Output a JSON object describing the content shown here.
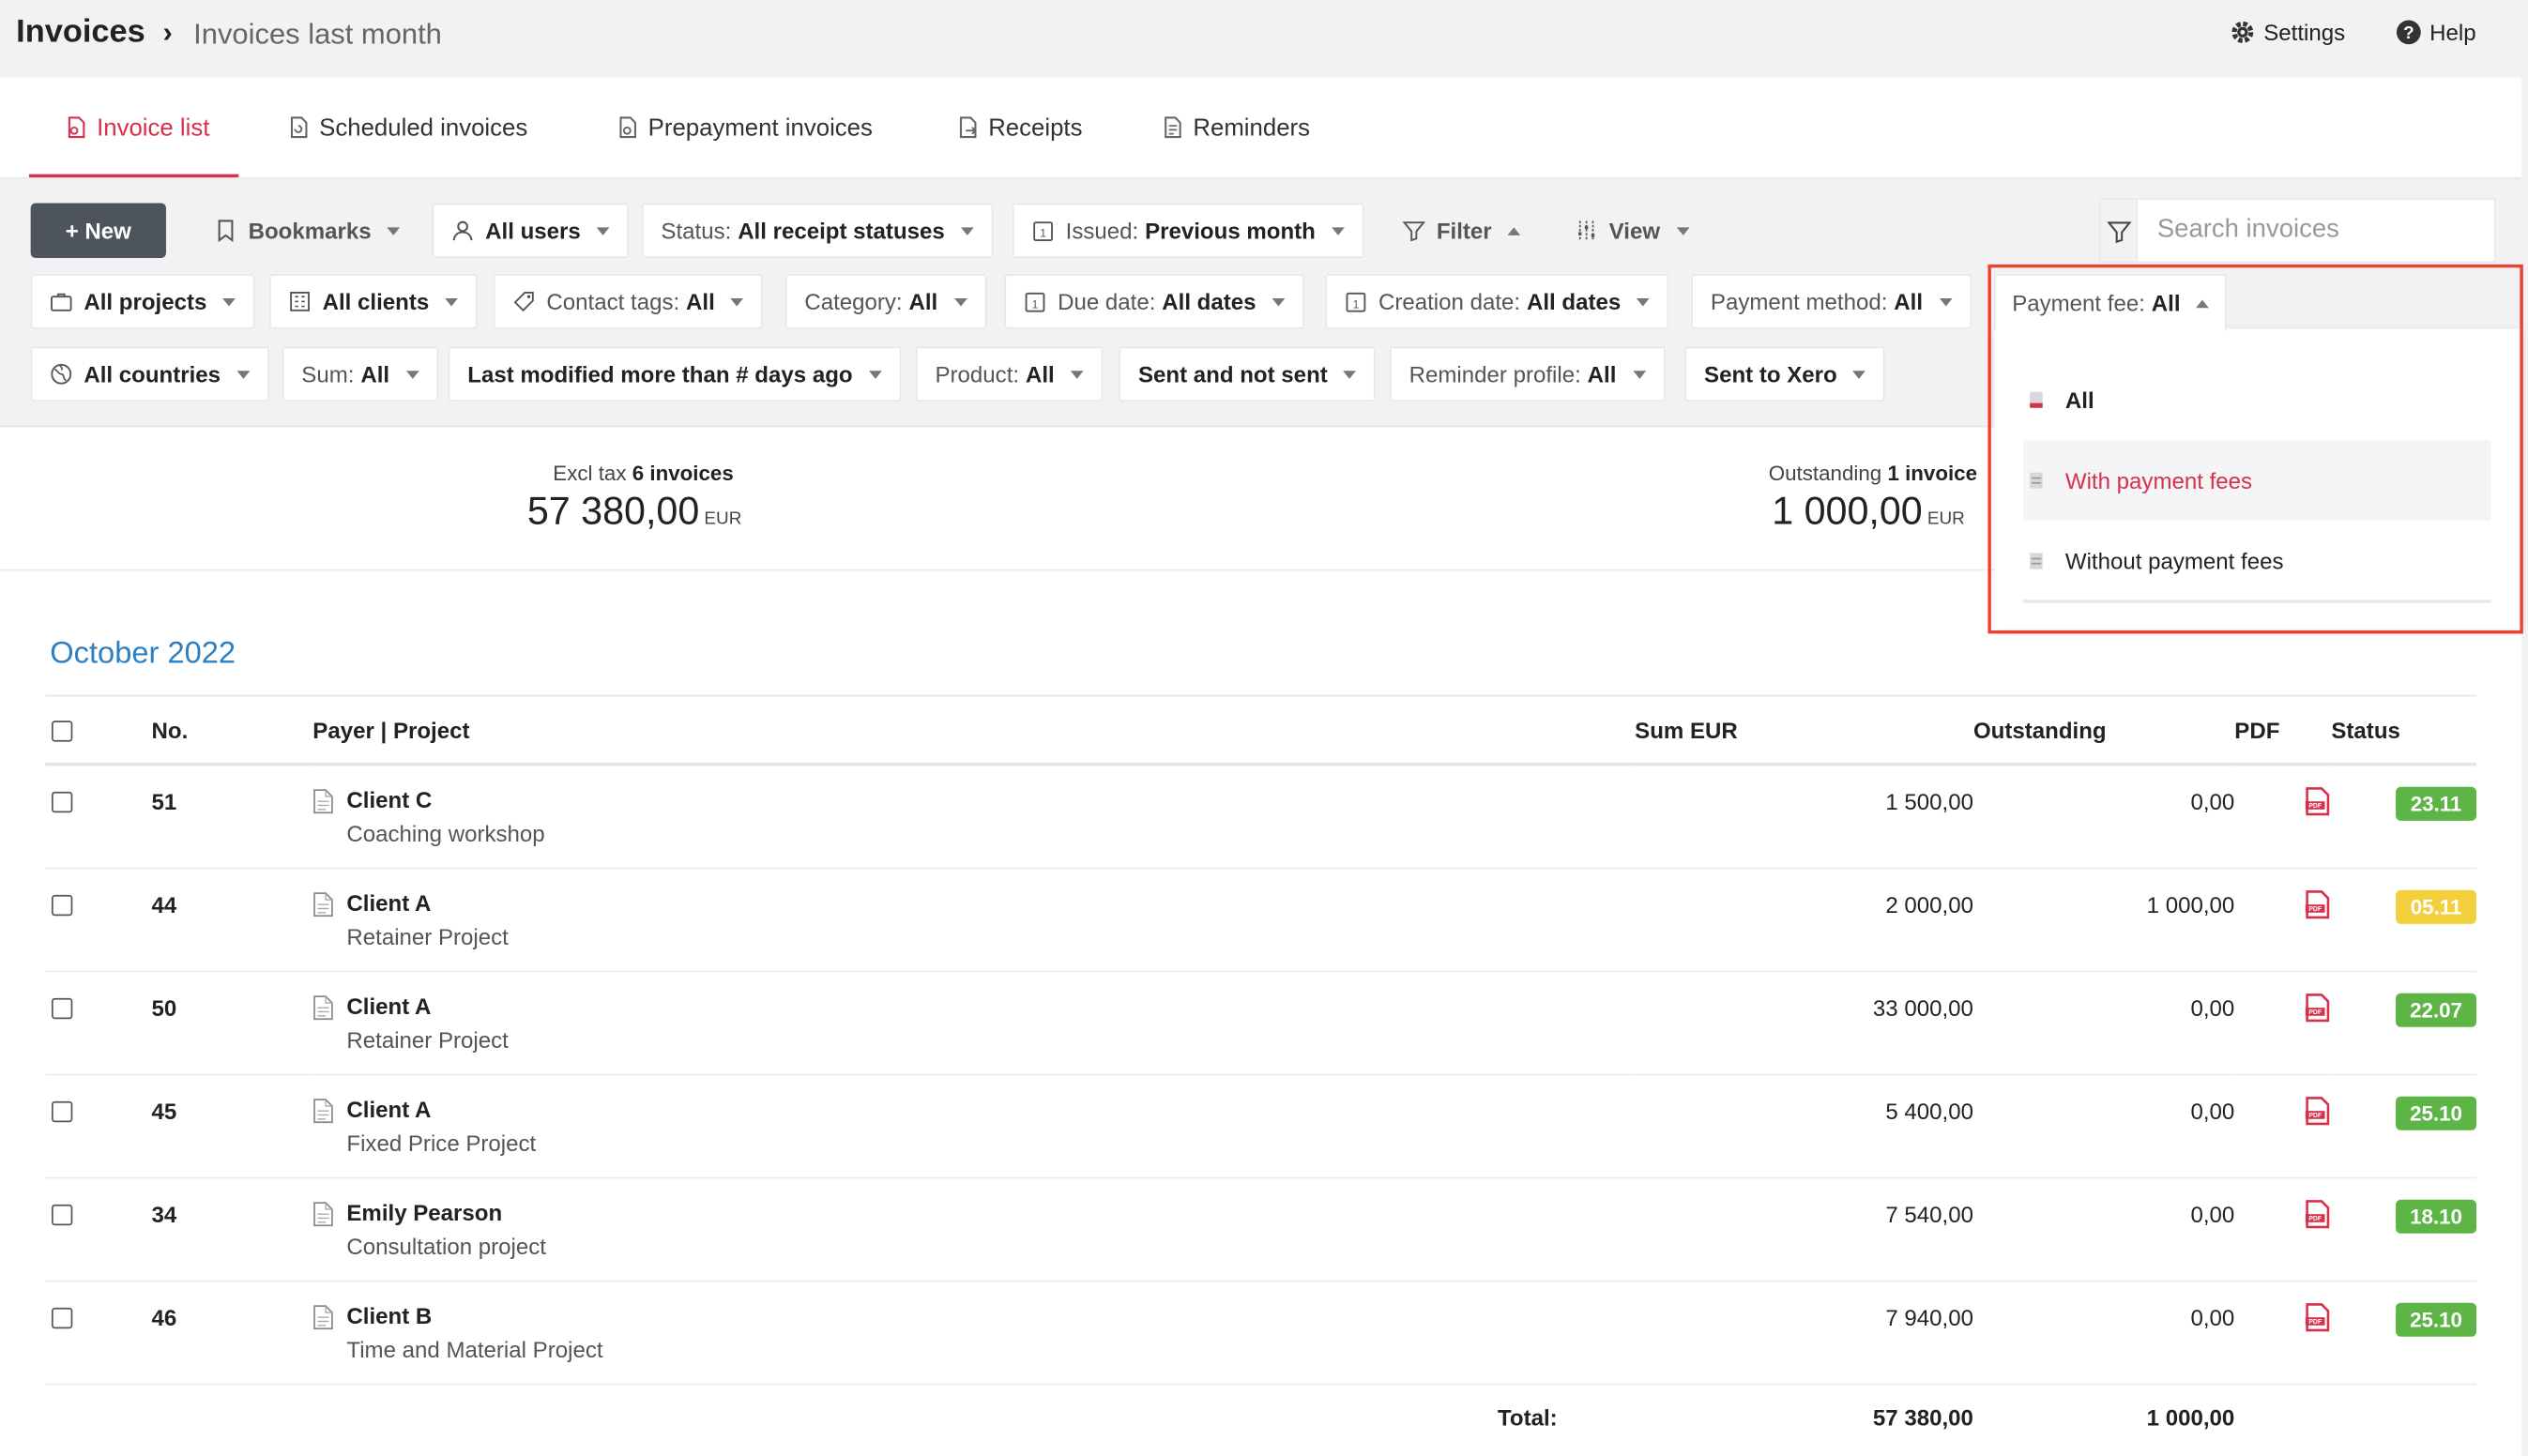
{
  "header": {
    "app_title": "Invoices",
    "breadcrumb_separator": "›",
    "breadcrumb": "Invoices last month",
    "settings_label": "Settings",
    "help_label": "Help"
  },
  "tabs": [
    {
      "label": "Invoice list",
      "active": true
    },
    {
      "label": "Scheduled invoices"
    },
    {
      "label": "Prepayment invoices"
    },
    {
      "label": "Receipts"
    },
    {
      "label": "Reminders"
    }
  ],
  "toolbar": {
    "new_label": "+ New",
    "bookmarks_label": "Bookmarks",
    "users_label": "All users",
    "status_prefix": "Status:",
    "status_value": "All receipt statuses",
    "issued_prefix": "Issued:",
    "issued_value": "Previous month",
    "filter_label": "Filter",
    "view_label": "View",
    "search_placeholder": "Search invoices"
  },
  "filters_row2": {
    "projects": "All projects",
    "clients": "All clients",
    "contact_tags_prefix": "Contact tags:",
    "contact_tags_value": "All",
    "category_prefix": "Category:",
    "category_value": "All",
    "due_date_prefix": "Due date:",
    "due_date_value": "All dates",
    "creation_date_prefix": "Creation date:",
    "creation_date_value": "All dates",
    "payment_method_prefix": "Payment method:",
    "payment_method_value": "All",
    "payment_fee_prefix": "Payment fee:",
    "payment_fee_value": "All"
  },
  "filters_row3": {
    "countries": "All countries",
    "sum_prefix": "Sum:",
    "sum_value": "All",
    "last_modified": "Last modified more than # days ago",
    "product_prefix": "Product:",
    "product_value": "All",
    "sent": "Sent and not sent",
    "reminder_prefix": "Reminder profile:",
    "reminder_value": "All",
    "xero": "Sent to Xero"
  },
  "payment_fee_dropdown": {
    "options": [
      {
        "label": "All",
        "selected": true
      },
      {
        "label": "With payment fees",
        "hovered": true
      },
      {
        "label": "Without payment fees"
      }
    ]
  },
  "summary": {
    "excl_tax_label": "Excl tax",
    "excl_tax_count": "6 invoices",
    "excl_tax_amount": "57 380,00",
    "excl_tax_currency": "EUR",
    "outstanding_label": "Outstanding",
    "outstanding_count": "1 invoice",
    "outstanding_amount": "1 000,00",
    "outstanding_currency": "EUR"
  },
  "month_heading": "October 2022",
  "table": {
    "columns": {
      "no": "No.",
      "payer": "Payer | Project",
      "sum": "Sum EUR",
      "outstanding": "Outstanding",
      "pdf": "PDF",
      "status": "Status"
    },
    "rows": [
      {
        "no": "51",
        "payer": "Client C",
        "project": "Coaching workshop",
        "sum": "1 500,00",
        "outstanding": "0,00",
        "status": "23.11",
        "status_color": "#5cb544"
      },
      {
        "no": "44",
        "payer": "Client A",
        "project": "Retainer Project",
        "sum": "2 000,00",
        "outstanding": "1 000,00",
        "status": "05.11",
        "status_color": "#f2cf3c"
      },
      {
        "no": "50",
        "payer": "Client A",
        "project": "Retainer Project",
        "sum": "33 000,00",
        "outstanding": "0,00",
        "status": "22.07",
        "status_color": "#5cb544"
      },
      {
        "no": "45",
        "payer": "Client A",
        "project": "Fixed Price Project",
        "sum": "5 400,00",
        "outstanding": "0,00",
        "status": "25.10",
        "status_color": "#5cb544"
      },
      {
        "no": "34",
        "payer": "Emily Pearson",
        "project": "Consultation project",
        "sum": "7 540,00",
        "outstanding": "0,00",
        "status": "18.10",
        "status_color": "#5cb544"
      },
      {
        "no": "46",
        "payer": "Client B",
        "project": "Time and Material Project",
        "sum": "7 940,00",
        "outstanding": "0,00",
        "status": "25.10",
        "status_color": "#5cb544"
      }
    ],
    "total_label": "Total:",
    "total_sum": "57 380,00",
    "total_outstanding": "1 000,00"
  },
  "colors": {
    "accent": "#d9304a",
    "link_blue": "#2d7fc4",
    "highlight_border": "#e8432d",
    "paid_green": "#5cb544",
    "due_yellow": "#f2cf3c"
  }
}
